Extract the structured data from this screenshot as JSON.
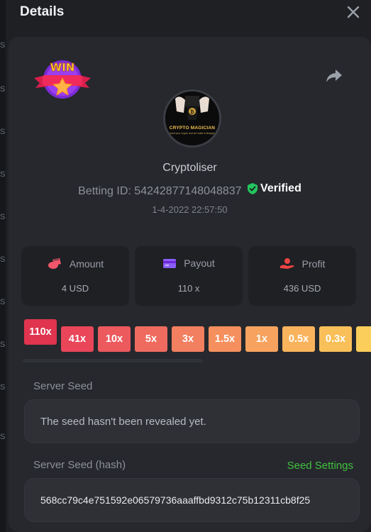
{
  "header": {
    "title": "Details"
  },
  "background_strip": [
    "S",
    "S",
    "S",
    "S",
    "S",
    "S",
    "S",
    "S",
    "S",
    "S"
  ],
  "badge": {
    "text": "WIN"
  },
  "avatar": {
    "line1": "CRYPTO MAGICIAN",
    "line2": "predict your crypto and we make it disappear"
  },
  "user": {
    "username": "Cryptoliser",
    "betting_id_label": "Betting ID:",
    "betting_id": "54242877148048837",
    "verified_label": "Verified",
    "timestamp": "1-4-2022 22:57:50"
  },
  "stats": [
    {
      "label": "Amount",
      "value": "4 USD",
      "icon": "coins-icon"
    },
    {
      "label": "Payout",
      "value": "110 x",
      "icon": "card-icon"
    },
    {
      "label": "Profit",
      "value": "436 USD",
      "icon": "hand-coin-icon"
    }
  ],
  "multipliers": [
    {
      "label": "110x",
      "color": "#e0344f",
      "active": true
    },
    {
      "label": "41x",
      "color": "#e9465a"
    },
    {
      "label": "10x",
      "color": "#ec5a5e"
    },
    {
      "label": "5x",
      "color": "#ef6b5f"
    },
    {
      "label": "3x",
      "color": "#f27f5f"
    },
    {
      "label": "1.5x",
      "color": "#f5905e"
    },
    {
      "label": "1x",
      "color": "#f7a35f"
    },
    {
      "label": "0.5x",
      "color": "#f8b35c"
    },
    {
      "label": "0.3x",
      "color": "#f9c05a"
    },
    {
      "label": "",
      "color": "#fbcd5a"
    }
  ],
  "server_seed": {
    "label": "Server Seed",
    "value": "The seed hasn't been revealed yet."
  },
  "server_seed_hash": {
    "label": "Server Seed (hash)",
    "settings_link": "Seed Settings",
    "value": "568cc79c4e751592e06579736aaaffbd9312c75b12311cb8f25"
  },
  "colors": {
    "accent_green": "#3fc33d",
    "verified_green": "#22c55e",
    "amount_icon": "#f0566a",
    "payout_icon": "#8b5cf6",
    "profit_icon": "#ef4444"
  }
}
